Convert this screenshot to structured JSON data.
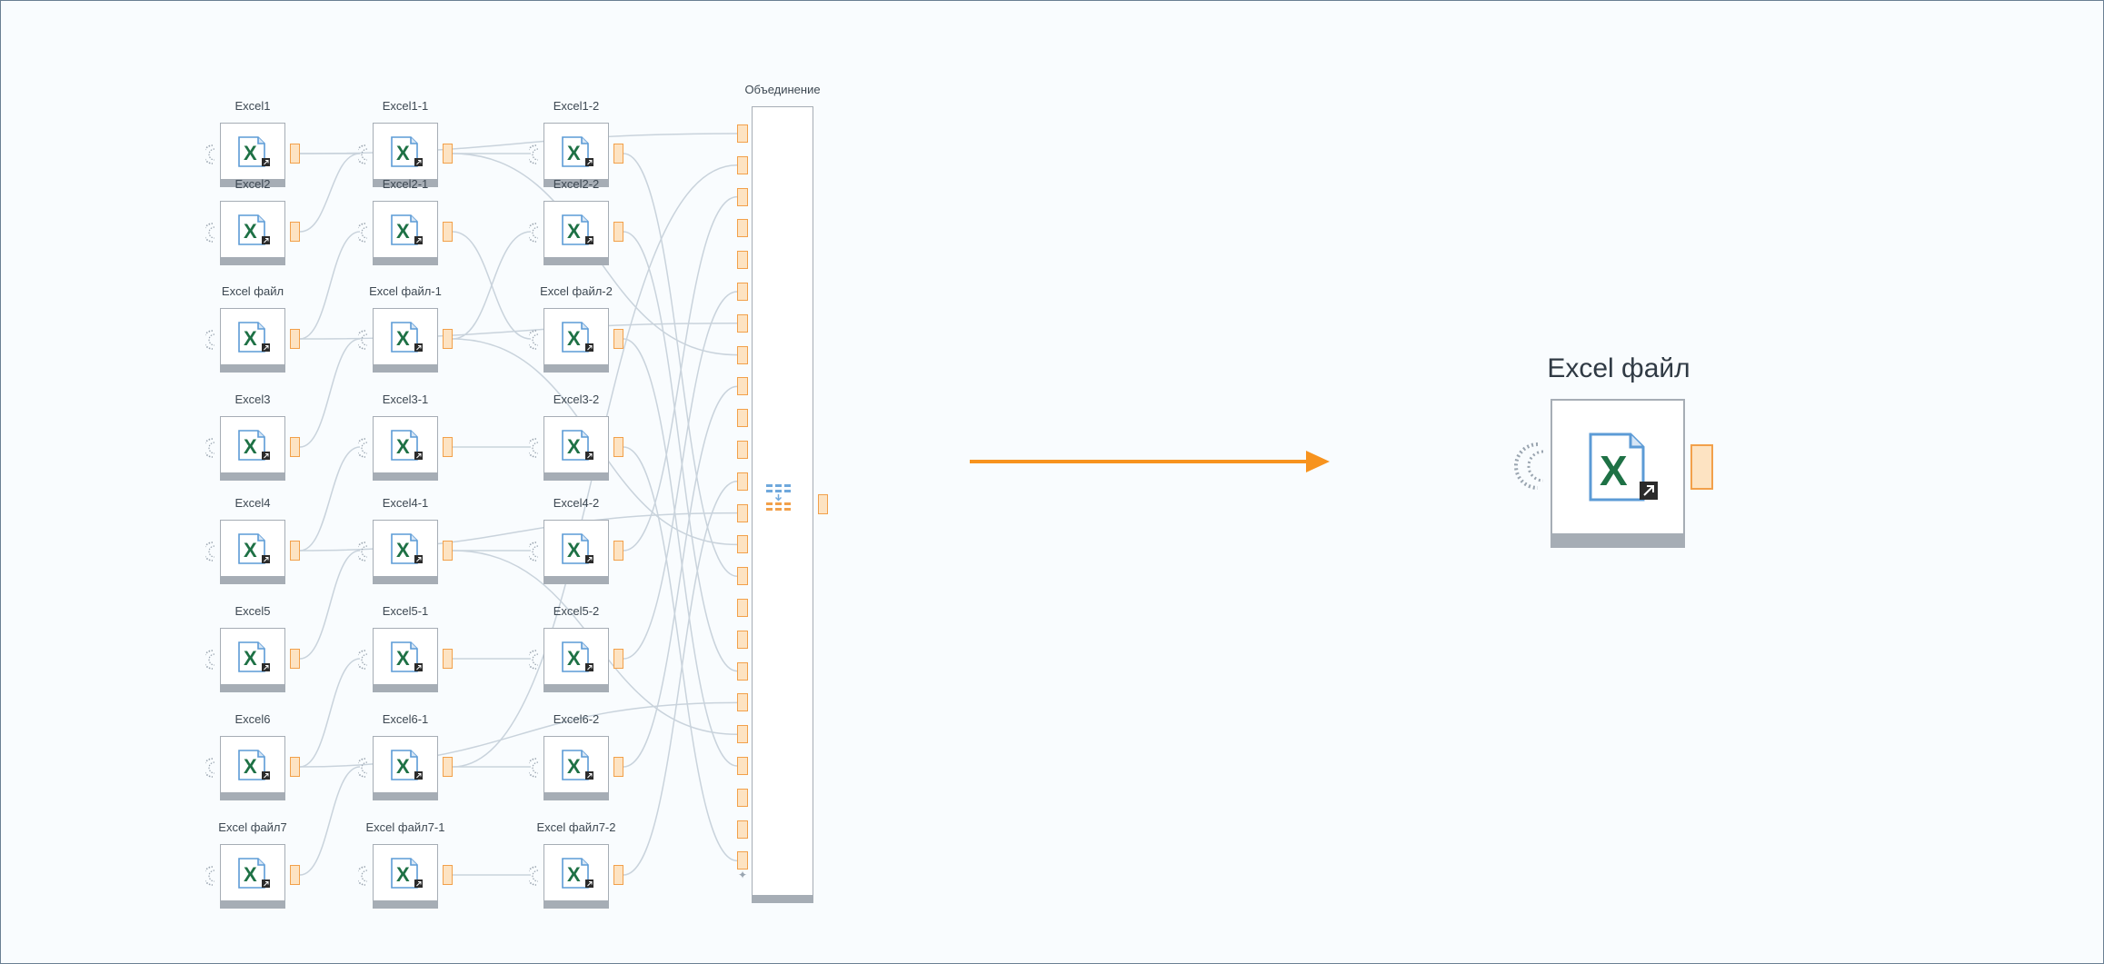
{
  "diagram": {
    "left_group": {
      "rows": [
        [
          "Excel1",
          "Excel1-1",
          "Excel1-2"
        ],
        [
          "Excel2",
          "Excel2-1",
          "Excel2-2"
        ],
        [
          "Excel файл",
          "Excel файл-1",
          "Excel файл-2"
        ],
        [
          "Excel3",
          "Excel3-1",
          "Excel3-2"
        ],
        [
          "Excel4",
          "Excel4-1",
          "Excel4-2"
        ],
        [
          "Excel5",
          "Excel5-1",
          "Excel5-2"
        ],
        [
          "Excel6",
          "Excel6-1",
          "Excel6-2"
        ],
        [
          "Excel файл7",
          "Excel файл7-1",
          "Excel файл7-2"
        ]
      ],
      "union_label": "Объединение",
      "union_input_count": 24,
      "icon": "excel-file-icon"
    },
    "arrow": {
      "icon": "arrow-right-icon",
      "color": "#f7931e"
    },
    "result": {
      "label": "Excel файл",
      "icon": "excel-file-icon"
    }
  },
  "colors": {
    "canvas": "#f9fcfe",
    "border": "#6a7f93",
    "port_fill": "#fde3c2",
    "port_stroke": "#f2a04a",
    "wire": "#c9d3dc",
    "excel_green": "#1e7145"
  }
}
